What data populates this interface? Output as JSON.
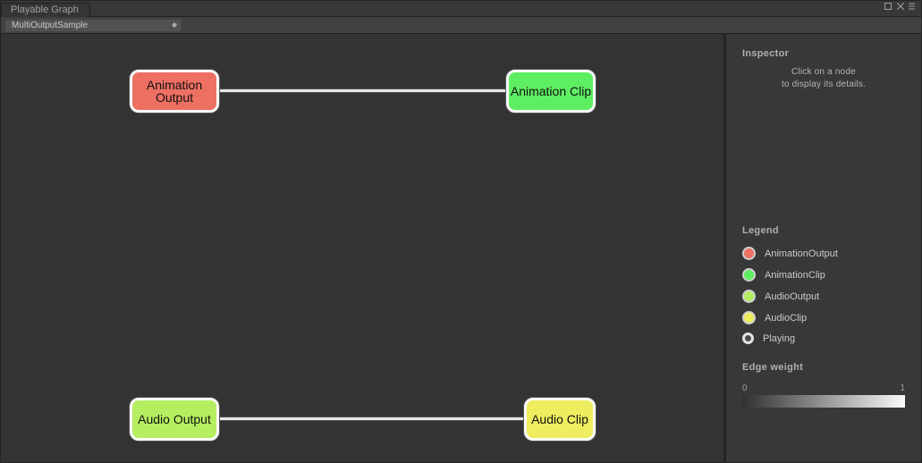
{
  "window": {
    "tab_title": "Playable Graph"
  },
  "toolbar": {
    "dropdown_value": "MultiOutputSample"
  },
  "graph": {
    "nodes": {
      "anim_output": {
        "label": "Animation Output"
      },
      "anim_clip": {
        "label": "Animation Clip"
      },
      "audio_output": {
        "label": "Audio Output"
      },
      "audio_clip": {
        "label": "Audio Clip"
      }
    }
  },
  "inspector": {
    "header": "Inspector",
    "hint_line1": "Click on a node",
    "hint_line2": "to display its details."
  },
  "legend": {
    "header": "Legend",
    "items": {
      "anim_output": "AnimationOutput",
      "anim_clip": "AnimationClip",
      "audio_output": "AudioOutput",
      "audio_clip": "AudioClip",
      "playing": "Playing"
    }
  },
  "edge_weight": {
    "header": "Edge weight",
    "min": "0",
    "max": "1"
  }
}
